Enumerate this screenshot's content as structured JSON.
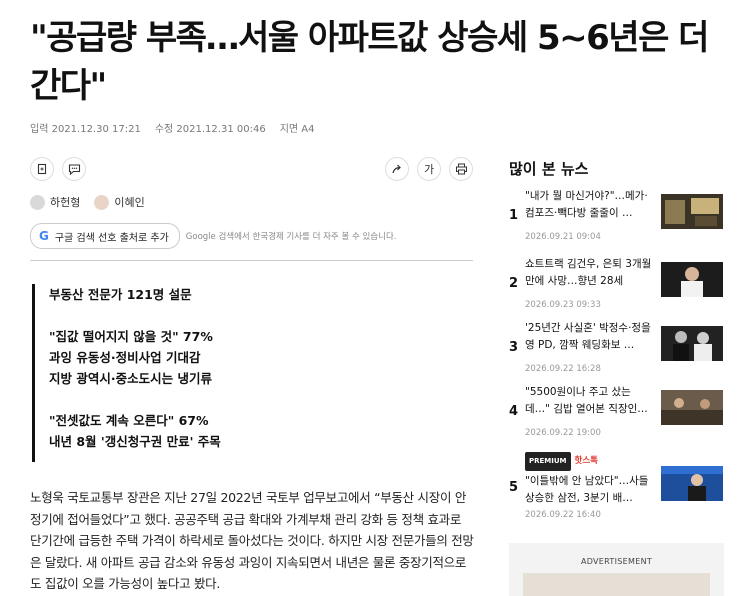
{
  "article": {
    "headline": "\"공급량 부족…서울 아파트값 상승세 5~6년은 더 간다\"",
    "meta": {
      "input": "입력 2021.12.30 17:21",
      "edit": "수정 2021.12.31 00:46",
      "page": "지면 A4"
    },
    "toolbar": {
      "bookmark_icon": "bookmark-icon",
      "comment_icon": "comment-icon",
      "share_icon": "share-icon",
      "font_label": "가",
      "print_icon": "print-icon"
    },
    "authors": [
      "하헌형",
      "이혜인"
    ],
    "google_button": "구글 검색 선호 출처로 추가",
    "google_note": "Google 검색에서 한국경제 기사를 더 자주 볼 수 있습니다.",
    "summary": {
      "line1": "부동산 전문가 121명 설문",
      "line2": "\"집값 떨어지지 않을 것\" 77%",
      "line3": "과잉 유동성·정비사업 기대감",
      "line4": "지방 광역시·중소도시는 냉기류",
      "line5": "\"전셋값도 계속 오른다\" 67%",
      "line6": "내년 8월 '갱신청구권 만료' 주목"
    },
    "body": "노형욱 국토교통부 장관은 지난 27일 2022년 국토부 업무보고에서 “부동산 시장이 안정기에 접어들었다”고 했다. 공공주택 공급 확대와 가계부채 관리 강화 등 정책 효과로 단기간에 급등한 주택 가격이 하락세로 돌아섰다는 것이다. 하지만 시장 전문가들의 전망은 달랐다. 새 아파트 공급 감소와 유동성 과잉이 지속되면서 내년은 물론 중장기적으로도 집값이 오를 가능성이 높다고 봤다."
  },
  "sidebar": {
    "title": "많이 본 뉴스",
    "items": [
      {
        "rank": "1",
        "title": "\"내가 뭘 마신거야?\"…메가·컴포즈·빽다방 줄줄이 …",
        "date": "2026.09.21 09:04"
      },
      {
        "rank": "2",
        "title": "쇼트트랙 김건우, 은퇴 3개월 만에 사망…향년 28세",
        "date": "2026.09.23 09:33"
      },
      {
        "rank": "3",
        "title": "'25년간 사실혼' 박정수·정을영 PD, 깜짝 웨딩화보 …",
        "date": "2026.09.22 16:28"
      },
      {
        "rank": "4",
        "title": "\"5500원이나 주고 샀는데…\" 김밥 열어본 직장인…",
        "date": "2026.09.22 19:00"
      },
      {
        "rank": "5",
        "badge_premium": "PREMIUM",
        "badge_hot": "핫스톡",
        "title": "\"이틀밖에 안 남았다\"…사들 상승한 삼전, 3분기 배…",
        "date": "2026.09.22 16:40"
      }
    ],
    "ad_label": "ADVERTISEMENT"
  }
}
